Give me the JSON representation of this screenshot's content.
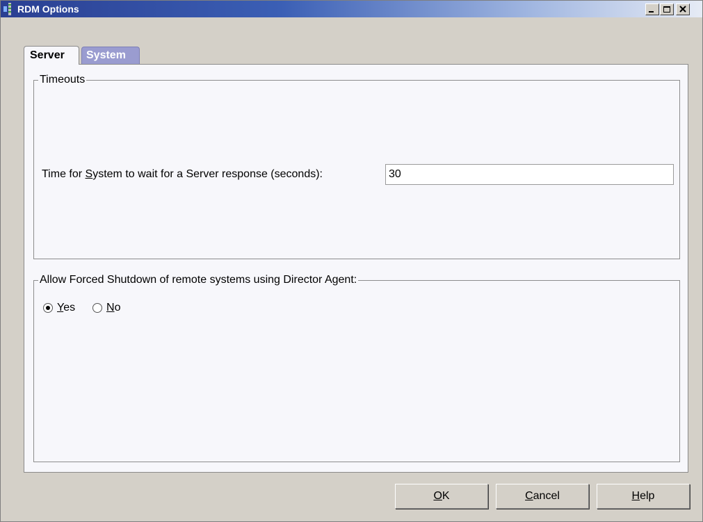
{
  "window": {
    "title": "RDM Options"
  },
  "tabs": [
    {
      "label": "Server",
      "selected": true
    },
    {
      "label": "System",
      "selected": false
    }
  ],
  "timeouts": {
    "legend": "Timeouts",
    "label_prefix": "Time for ",
    "label_mnemonic": "S",
    "label_suffix": "ystem to wait for a Server response (seconds):",
    "value": "30"
  },
  "shutdown": {
    "legend": "Allow Forced Shutdown of remote systems using Director Agent:",
    "options": [
      {
        "mnemonic": "Y",
        "rest": "es",
        "selected": true
      },
      {
        "mnemonic": "N",
        "rest": "o",
        "selected": false
      }
    ]
  },
  "buttons": {
    "ok": {
      "mnemonic": "O",
      "rest": "K"
    },
    "cancel": {
      "mnemonic": "C",
      "rest": "ancel"
    },
    "help": {
      "mnemonic": "H",
      "rest": "elp"
    }
  },
  "colors": {
    "titlebar_start": "#2a3f92",
    "tab_selected": "#f7f7fb",
    "tab_unselected": "#9a9cd0",
    "dialog_bg": "#d4d0c8"
  }
}
